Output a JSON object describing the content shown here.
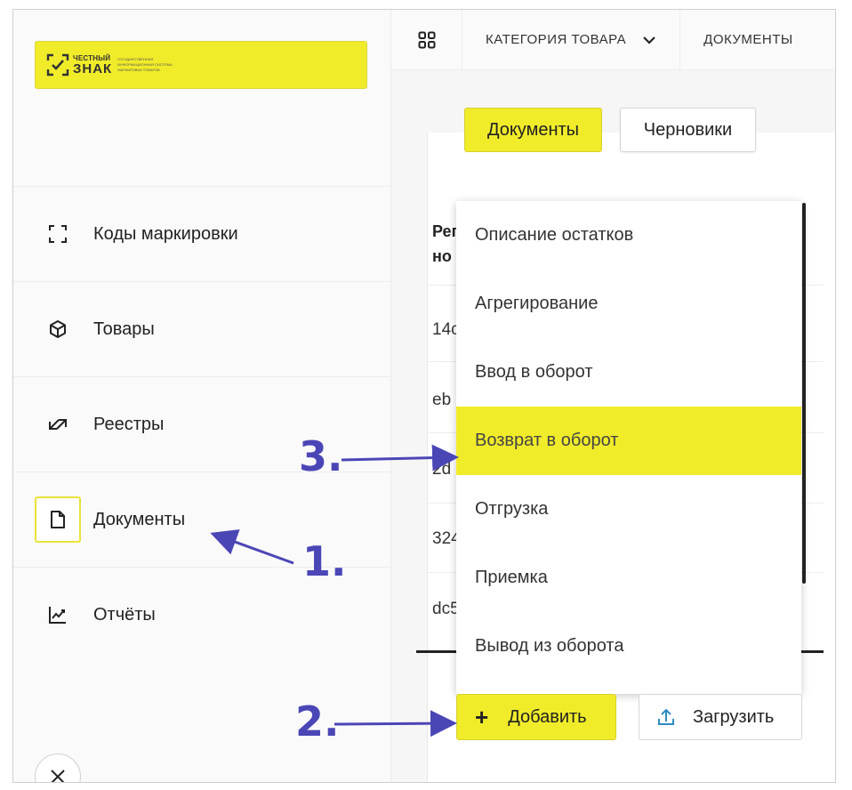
{
  "logo": {
    "brand_top": "ЧЕСТНЫЙ",
    "brand_main": "ЗНАК",
    "tagline": [
      "ГОСУДАРСТВЕННАЯ",
      "ИНФОРМАЦИОННАЯ СИСТЕМА",
      "МАРКИРОВКИ ТОВАРОВ"
    ],
    "color": "#f1ec2a"
  },
  "sidebar": {
    "items": [
      {
        "label": "Коды маркировки",
        "icon": "scan-frame-icon"
      },
      {
        "label": "Товары",
        "icon": "box-icon"
      },
      {
        "label": "Реестры",
        "icon": "swap-arrows-icon"
      },
      {
        "label": "Документы",
        "icon": "document-icon",
        "active": true
      },
      {
        "label": "Отчёты",
        "icon": "chart-icon"
      }
    ]
  },
  "topbar": {
    "category": "КАТЕГОРИЯ ТОВАРА",
    "documents": "ДОКУМЕНТЫ"
  },
  "tabs": {
    "primary": "Документы",
    "secondary": "Черновики"
  },
  "table": {
    "header_line1": "Рег",
    "header_line2": "но",
    "row_fragments": [
      "14c",
      "eb",
      "2d",
      "324",
      "dc5"
    ]
  },
  "dropdown": {
    "items": [
      "Описание остатков",
      "Агрегирование",
      "Ввод в оборот",
      "Возврат в оборот",
      "Отгрузка",
      "Приемка",
      "Вывод из оборота"
    ],
    "highlighted_index": 3
  },
  "actions": {
    "add": "Добавить",
    "upload": "Загрузить"
  },
  "annotations": {
    "step1": "1.",
    "step2": "2.",
    "step3": "3.",
    "color": "#4b46b6"
  }
}
